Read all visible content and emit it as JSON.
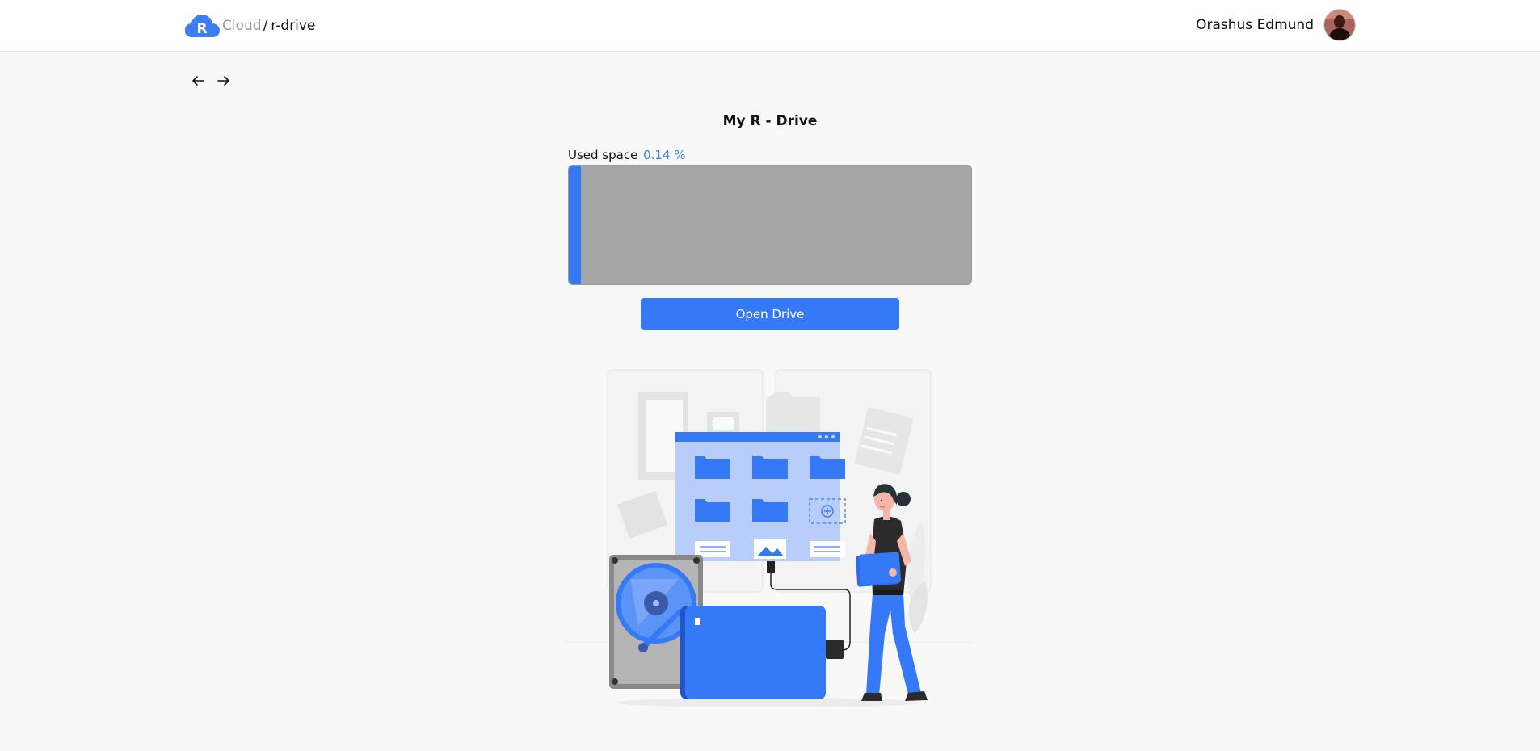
{
  "header": {
    "logo_letter": "R",
    "app_name": "Cloud",
    "separator": "/",
    "page_name": "r-drive",
    "user_name": "Orashus Edmund"
  },
  "nav": {
    "back_icon": "arrow-left-icon",
    "forward_icon": "arrow-right-icon"
  },
  "main": {
    "title": "My R - Drive",
    "used_space_label": "Used space",
    "used_space_value": "0.14 %",
    "used_space_percent": 0.14,
    "open_button_label": "Open Drive"
  },
  "colors": {
    "accent": "#3579f6",
    "bar_track": "#a5a5a5",
    "page_bg": "#f8f8f8",
    "header_bg": "#ffffff"
  }
}
